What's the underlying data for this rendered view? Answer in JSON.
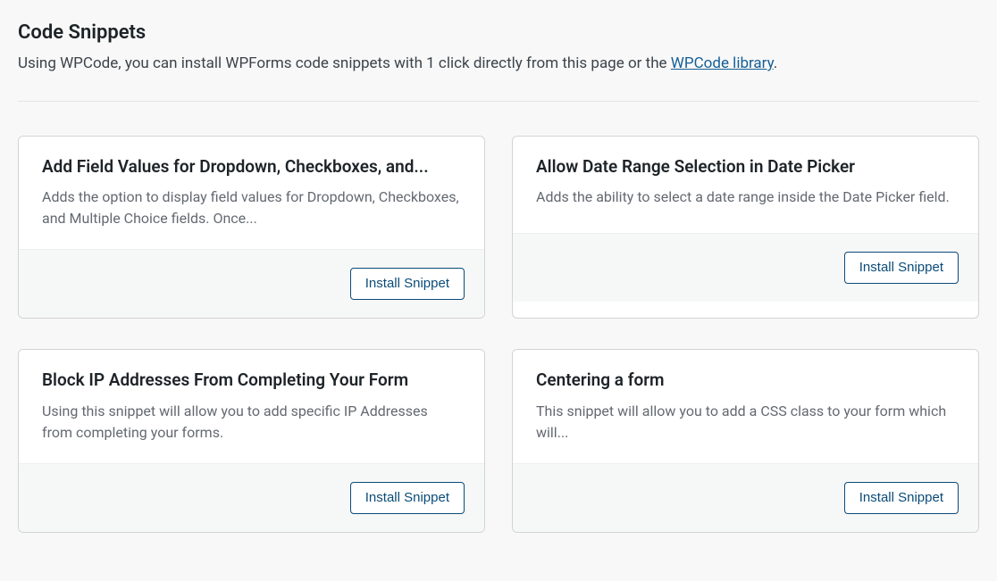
{
  "header": {
    "title": "Code Snippets",
    "intro_prefix": "Using WPCode, you can install WPForms code snippets with 1 click directly from this page or the ",
    "intro_link_text": "WPCode library",
    "intro_suffix": "."
  },
  "cards": [
    {
      "title": "Add Field Values for Dropdown, Checkboxes, and...",
      "description": "Adds the option to display field values for Dropdown, Checkboxes, and Multiple Choice fields. Once...",
      "button": "Install Snippet"
    },
    {
      "title": "Allow Date Range Selection in Date Picker",
      "description": "Adds the ability to select a date range inside the Date Picker field.",
      "button": "Install Snippet"
    },
    {
      "title": "Block IP Addresses From Completing Your Form",
      "description": "Using this snippet will allow you to add specific IP Addresses from completing your forms.",
      "button": "Install Snippet"
    },
    {
      "title": "Centering a form",
      "description": "This snippet will allow you to add a CSS class to your form which will...",
      "button": "Install Snippet"
    }
  ]
}
